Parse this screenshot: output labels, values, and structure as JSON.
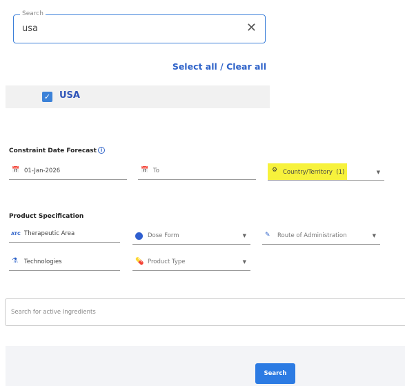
{
  "search": {
    "legend": "Search",
    "value": "usa",
    "clear_icon": "close-icon",
    "select_all_label": "Select all",
    "separator": " / ",
    "clear_all_label": "Clear all"
  },
  "options": [
    {
      "label": "USA",
      "checked": true
    }
  ],
  "constraint": {
    "title": "Constraint Date Forecast",
    "info_icon": "info-icon",
    "from_value": "01-Jan-2026",
    "to_placeholder": "To",
    "country_label": "Country/Territory",
    "country_count": "(1)"
  },
  "product": {
    "title": "Product Specification",
    "therapeutic_area": "Therapeutic Area",
    "therapeutic_icon_text": "ATC",
    "dose_form": "Dose Form",
    "route": "Route of Administration",
    "technologies": "Technologies",
    "product_type": "Product Type"
  },
  "ingredients": {
    "placeholder": "Search for active Ingredients"
  },
  "footer": {
    "search_button": "Search"
  },
  "colors": {
    "accent": "#2f63c9",
    "button": "#2c7be3",
    "highlight": "#f7f23c"
  }
}
